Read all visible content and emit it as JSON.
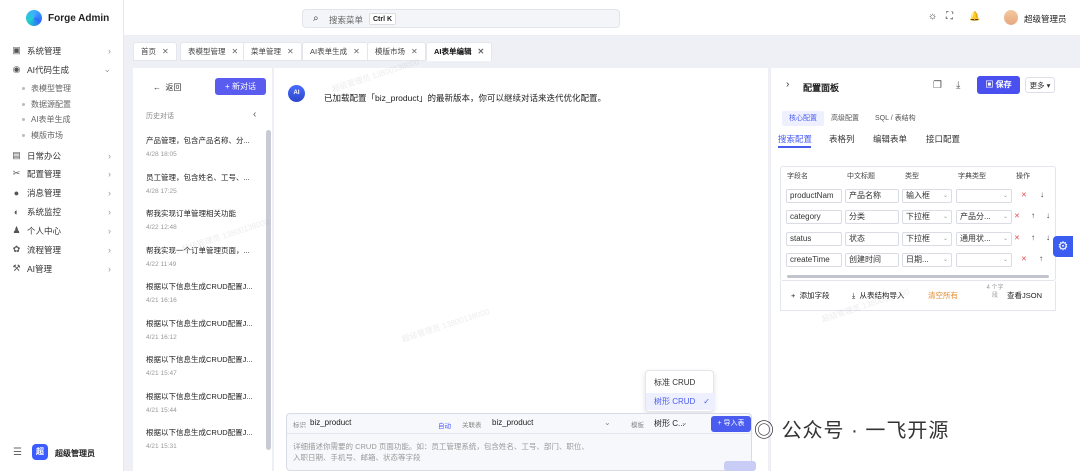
{
  "app": {
    "name": "Forge Admin"
  },
  "sidebar": {
    "items": [
      {
        "label": "系统管理",
        "icon": "briefcase-icon",
        "glyph": "▣"
      },
      {
        "label": "AI代码生成",
        "icon": "ai-icon",
        "glyph": "◉",
        "expanded": true
      },
      {
        "label": "日常办公",
        "icon": "calendar-icon",
        "glyph": "▤"
      },
      {
        "label": "配置管理",
        "icon": "tools-icon",
        "glyph": "✂"
      },
      {
        "label": "消息管理",
        "icon": "message-icon",
        "glyph": "●"
      },
      {
        "label": "系统监控",
        "icon": "monitor-icon",
        "glyph": "◐"
      },
      {
        "label": "个人中心",
        "icon": "user-icon",
        "glyph": "♟"
      },
      {
        "label": "流程管理",
        "icon": "flow-icon",
        "glyph": "✿"
      },
      {
        "label": "AI管理",
        "icon": "wrench-icon",
        "glyph": "⚒"
      }
    ],
    "subitems": [
      "表模型管理",
      "数据源配置",
      "AI表单生成",
      "模版市场"
    ],
    "footer": {
      "avatar_text": "超",
      "name": "超级管理员",
      "collapse_glyph": "☰"
    }
  },
  "header": {
    "search_placeholder": "搜索菜单",
    "search_shortcut": "Ctrl K",
    "icons": {
      "theme": "☼",
      "fullscreen": "⛶",
      "bell": "🔔"
    },
    "user_name": "超级管理员"
  },
  "tabs": [
    {
      "label": "首页"
    },
    {
      "label": "表模型管理"
    },
    {
      "label": "菜单管理"
    },
    {
      "label": "AI表单生成"
    },
    {
      "label": "模版市场"
    },
    {
      "label": "AI表单编辑",
      "active": true
    }
  ],
  "history": {
    "back_label": "返回",
    "new_chat_label": "新对话",
    "title": "历史对话",
    "items": [
      {
        "title": "产品管理，包含产品名称、分...",
        "date": "4/28 18:05"
      },
      {
        "title": "员工管理，包含姓名、工号、...",
        "date": "4/28 17:25"
      },
      {
        "title": "帮我实现订单管理相关功能",
        "date": "4/22 12:48"
      },
      {
        "title": "帮我实现一个订单管理页面，...",
        "date": "4/22 11:49"
      },
      {
        "title": "根据以下信息生成CRUD配置J...",
        "date": "4/21 16:16"
      },
      {
        "title": "根据以下信息生成CRUD配置J...",
        "date": "4/21 16:12"
      },
      {
        "title": "根据以下信息生成CRUD配置J...",
        "date": "4/21 15:47"
      },
      {
        "title": "根据以下信息生成CRUD配置J...",
        "date": "4/21 15:44"
      },
      {
        "title": "根据以下信息生成CRUD配置J...",
        "date": "4/21 15:31"
      }
    ]
  },
  "chat": {
    "ai_avatar": "AI",
    "message": "已加载配置「biz_product」的最新版本，你可以继续对话来迭代优化配置。",
    "composer": {
      "id_label": "标识",
      "id_value": "biz_product",
      "auto_label": "自动",
      "table_label": "关联表",
      "table_value": "biz_product",
      "template_label": "模板",
      "template_value": "树形 C...",
      "import_label": "导入表",
      "placeholder": "详细描述你需要的 CRUD 页面功能。如：员工管理系统，包含姓名、工号、部门、职位、入职日期、手机号、邮箱、状态等字段"
    },
    "template_options": [
      {
        "label": "标准 CRUD",
        "selected": false
      },
      {
        "label": "树形 CRUD",
        "selected": true
      }
    ]
  },
  "config": {
    "title": "配置面板",
    "save_label": "保存",
    "more_label": "更多",
    "segments": [
      "核心配置",
      "高级配置",
      "SQL / 表结构"
    ],
    "subtabs": [
      "搜索配置",
      "表格列",
      "编辑表单",
      "接口配置"
    ],
    "columns": [
      "字段名",
      "中文标题",
      "类型",
      "字典类型",
      "操作"
    ],
    "rows": [
      {
        "field": "productNam",
        "title": "产品名称",
        "type": "输入框",
        "dict": ""
      },
      {
        "field": "category",
        "title": "分类",
        "type": "下拉框",
        "dict": "产品分..."
      },
      {
        "field": "status",
        "title": "状态",
        "type": "下拉框",
        "dict": "通用状..."
      },
      {
        "field": "createTime",
        "title": "创建时间",
        "type": "日期...",
        "dict": ""
      }
    ],
    "footer": {
      "add_label": "添加字段",
      "import_label": "从表结构导入",
      "clear_label": "清空所有",
      "count_label": "4 个字段",
      "json_label": "查看JSON"
    }
  },
  "watermark": "超级管理员 13800138000",
  "brand_overlay": "公众号 · 一飞开源",
  "colors": {
    "accent": "#4a5cf0",
    "danger": "#e34b4b",
    "warning": "#e5892b"
  }
}
